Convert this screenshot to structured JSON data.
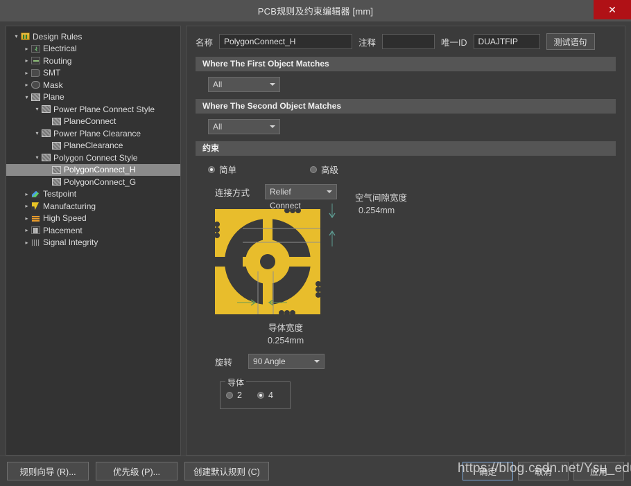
{
  "window": {
    "title": "PCB规则及约束编辑器 [mm]",
    "close_label": "✕"
  },
  "tree": {
    "items": [
      {
        "label": "Design Rules",
        "depth": 0,
        "twisty": "open",
        "icon": "folder-icon",
        "selected": false
      },
      {
        "label": "Electrical",
        "depth": 1,
        "twisty": "closed",
        "icon": "electrical-icon",
        "selected": false
      },
      {
        "label": "Routing",
        "depth": 1,
        "twisty": "closed",
        "icon": "routing-icon",
        "selected": false
      },
      {
        "label": "SMT",
        "depth": 1,
        "twisty": "closed",
        "icon": "smt-icon",
        "selected": false
      },
      {
        "label": "Mask",
        "depth": 1,
        "twisty": "closed",
        "icon": "mask-icon",
        "selected": false
      },
      {
        "label": "Plane",
        "depth": 1,
        "twisty": "open",
        "icon": "plane-icon",
        "selected": false
      },
      {
        "label": "Power Plane Connect Style",
        "depth": 2,
        "twisty": "open",
        "icon": "plane-icon",
        "selected": false
      },
      {
        "label": "PlaneConnect",
        "depth": 3,
        "twisty": "none",
        "icon": "plane-icon",
        "selected": false
      },
      {
        "label": "Power Plane Clearance",
        "depth": 2,
        "twisty": "open",
        "icon": "plane-icon",
        "selected": false
      },
      {
        "label": "PlaneClearance",
        "depth": 3,
        "twisty": "none",
        "icon": "plane-icon",
        "selected": false
      },
      {
        "label": "Polygon Connect Style",
        "depth": 2,
        "twisty": "open",
        "icon": "plane-icon",
        "selected": false
      },
      {
        "label": "PolygonConnect_H",
        "depth": 3,
        "twisty": "none",
        "icon": "plane-icon",
        "selected": true
      },
      {
        "label": "PolygonConnect_G",
        "depth": 3,
        "twisty": "none",
        "icon": "plane-icon",
        "selected": false
      },
      {
        "label": "Testpoint",
        "depth": 1,
        "twisty": "closed",
        "icon": "testpoint-icon",
        "selected": false
      },
      {
        "label": "Manufacturing",
        "depth": 1,
        "twisty": "closed",
        "icon": "manufacturing-icon",
        "selected": false
      },
      {
        "label": "High Speed",
        "depth": 1,
        "twisty": "closed",
        "icon": "high-speed-icon",
        "selected": false
      },
      {
        "label": "Placement",
        "depth": 1,
        "twisty": "closed",
        "icon": "placement-icon",
        "selected": false
      },
      {
        "label": "Signal Integrity",
        "depth": 1,
        "twisty": "closed",
        "icon": "signal-integrity-icon",
        "selected": false
      }
    ]
  },
  "form": {
    "name_label": "名称",
    "name_value": "PolygonConnect_H",
    "comment_label": "注释",
    "comment_value": "",
    "comment_placeholder": "",
    "unique_id_label": "唯一ID",
    "unique_id_value": "DUAJTFIP",
    "test_button": "测试语句"
  },
  "first_match": {
    "header": "Where The First Object Matches",
    "scope_value": "All"
  },
  "second_match": {
    "header": "Where The Second Object Matches",
    "scope_value": "All"
  },
  "constraints": {
    "header": "约束",
    "mode_simple": "简单",
    "mode_advanced": "高级",
    "mode_selected": "简单",
    "connect_style_label": "连接方式",
    "connect_style_value": "Relief Connect",
    "air_gap_label": "空气间隙宽度",
    "air_gap_value": "0.254mm",
    "conductor_width_label": "导体宽度",
    "conductor_width_value": "0.254mm",
    "rotation_label": "旋转",
    "rotation_value": "90 Angle",
    "conductors_group_label": "导体",
    "conductors_option_2": "2",
    "conductors_option_4": "4",
    "conductors_selected": "4"
  },
  "footer": {
    "rule_wizard": "规则向导 (R)...",
    "priority": "优先级 (P)...",
    "create_default": "创建默认规则 (C)",
    "ok": "确定",
    "cancel": "取消",
    "apply": "应用"
  },
  "overlay": {
    "watermark": "https://blog.csdn.net/Ysu_edu"
  },
  "colors": {
    "copper": "#e8bd2c",
    "dialog_bg": "#3f3f3f",
    "close_red": "#b01116",
    "dim_green": "#6a9a55",
    "dim_teal": "#5e9b92"
  }
}
